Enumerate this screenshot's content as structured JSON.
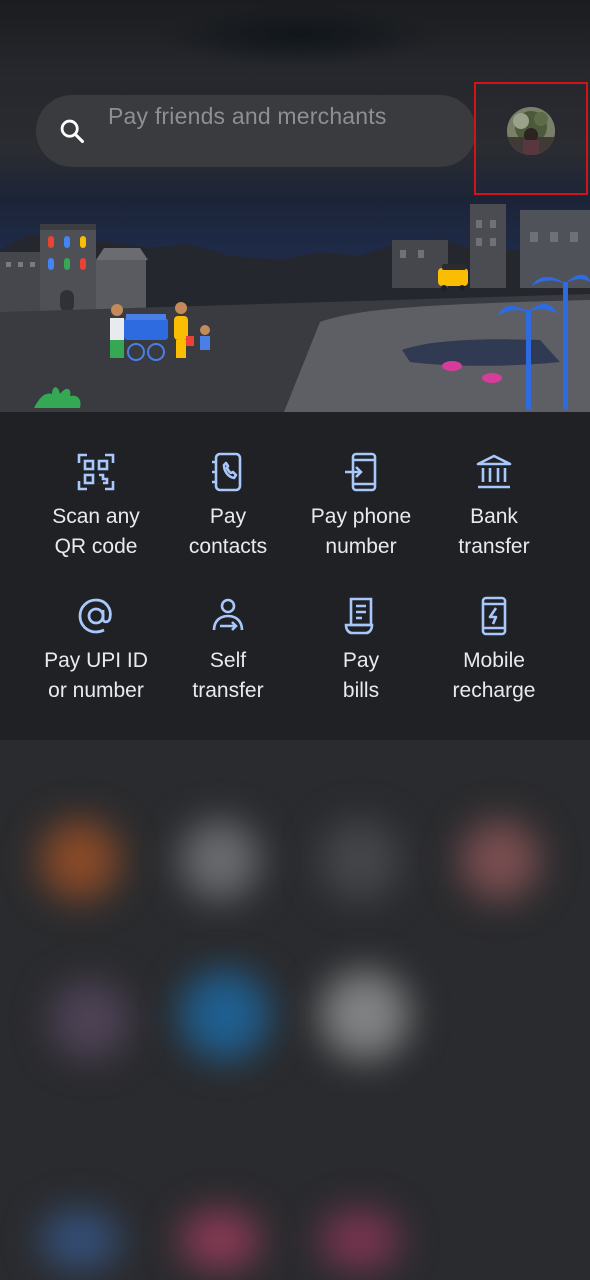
{
  "search": {
    "placeholder": "Pay friends and merchants"
  },
  "profile": {
    "icon": "account-avatar-icon"
  },
  "actions": [
    {
      "line1": "Scan any",
      "line2": "QR code",
      "icon": "qr-scan-icon"
    },
    {
      "line1": "Pay",
      "line2": "contacts",
      "icon": "contacts-phone-icon"
    },
    {
      "line1": "Pay phone",
      "line2": "number",
      "icon": "phone-arrow-icon"
    },
    {
      "line1": "Bank",
      "line2": "transfer",
      "icon": "bank-icon"
    },
    {
      "line1": "Pay UPI ID",
      "line2": "or number",
      "icon": "at-symbol-icon"
    },
    {
      "line1": "Self",
      "line2": "transfer",
      "icon": "self-transfer-icon"
    },
    {
      "line1": "Pay",
      "line2": "bills",
      "icon": "bill-icon"
    },
    {
      "line1": "Mobile",
      "line2": "recharge",
      "icon": "mobile-recharge-icon"
    }
  ],
  "colors": {
    "icon_accent": "#a8c7fa",
    "background": "#202124",
    "search_bg": "#3a3b3f",
    "highlight_border": "#d0141a"
  }
}
